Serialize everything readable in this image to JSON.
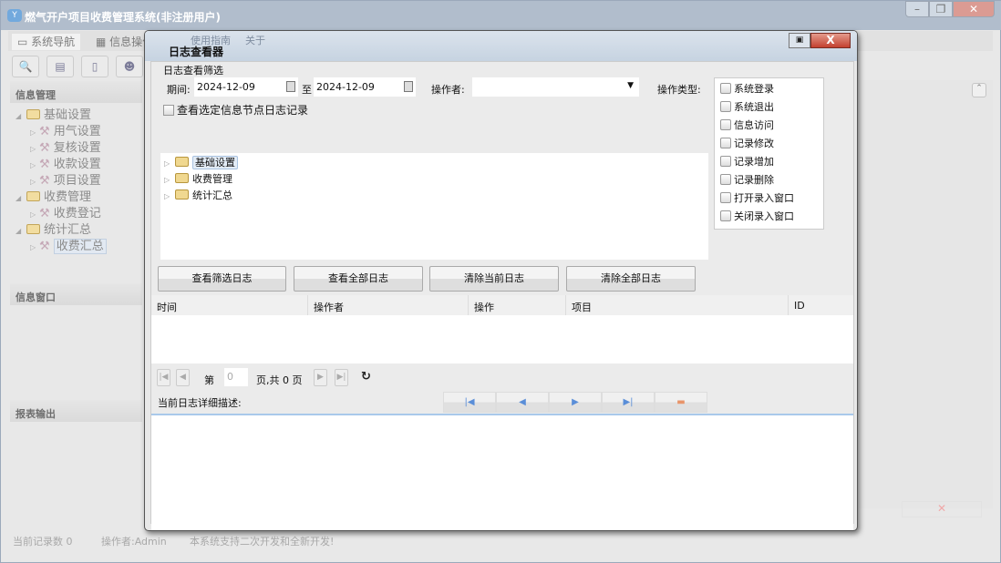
{
  "app": {
    "title": "燃气开户项目收费管理系统(非注册用户)",
    "logo": "YF",
    "menu_tabs": [
      "系统导航",
      "信息操作",
      "使用指南",
      "关于"
    ],
    "panels": {
      "info_management": "信息管理",
      "info_window": "信息窗口",
      "report_output": "报表输出"
    },
    "nav_tree": [
      {
        "label": "基础设置",
        "children": [
          "用气设置",
          "复核设置",
          "收款设置",
          "项目设置"
        ]
      },
      {
        "label": "收费管理",
        "children": [
          "收费登记"
        ]
      },
      {
        "label": "统计汇总",
        "children": [
          "收费汇总"
        ]
      }
    ],
    "selected_node": "收费汇总",
    "status": {
      "record_count": "当前记录数 0",
      "operator": "操作者:Admin",
      "notice": "本系统支持二次开发和全新开发!"
    }
  },
  "dialog": {
    "title": "日志查看器",
    "filter": {
      "group_label": "日志查看筛选",
      "period_label": "期间:",
      "date_from": "2024-12-09",
      "to_label": "至",
      "date_to": "2024-12-09",
      "operator_label": "操作者:",
      "operator_value": "",
      "op_type_label": "操作类型:",
      "node_checkbox_label": "查看选定信息节点日志记录",
      "op_types": [
        "系统登录",
        "系统退出",
        "信息访问",
        "记录修改",
        "记录增加",
        "记录删除",
        "打开录入窗口",
        "关闭录入窗口"
      ],
      "tree": [
        "基础设置",
        "收费管理",
        "统计汇总"
      ]
    },
    "buttons": [
      "查看筛选日志",
      "查看全部日志",
      "清除当前日志",
      "清除全部日志"
    ],
    "table": {
      "columns": [
        "时间",
        "操作者",
        "操作",
        "项目",
        "ID"
      ],
      "rows": []
    },
    "pager": {
      "page_prefix": "第",
      "page_value": "0",
      "page_suffix": "页,共 0 页"
    },
    "detail_label": "当前日志详细描述:"
  }
}
